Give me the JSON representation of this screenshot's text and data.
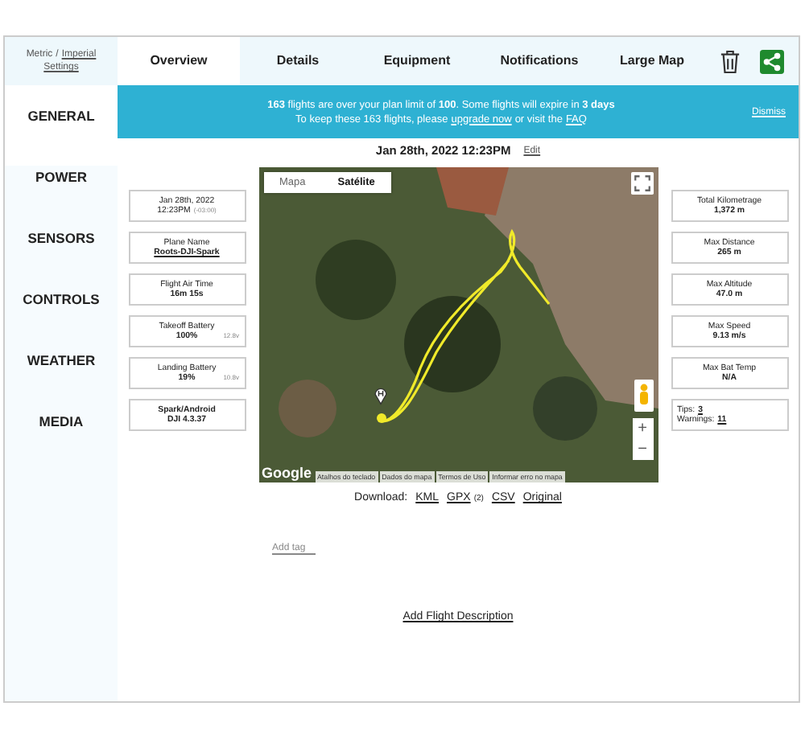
{
  "units": [
    {
      "label": "Metric",
      "selected": true
    },
    {
      "label": "Imperial",
      "selected": false
    }
  ],
  "units_separator": "/",
  "settings_link": "Settings",
  "tabs": [
    {
      "label": "Overview",
      "selected": true
    },
    {
      "label": "Details",
      "selected": false
    },
    {
      "label": "Equipment",
      "selected": false
    },
    {
      "label": "Notifications",
      "selected": false
    },
    {
      "label": "Large Map",
      "selected": false
    }
  ],
  "banner": {
    "line1": "**163** flights are over your plan limit of **100**. Some flights will expire in **3 days**",
    "line2": [
      {
        "text": "To keep these 163 flights, please",
        "link": false
      },
      {
        "text": "upgrade now",
        "link": true
      },
      {
        "text": "or visit the",
        "link": false
      },
      {
        "text": "FAQ",
        "link": true
      }
    ],
    "dismiss": "Dismiss"
  },
  "sidebar": {
    "items": [
      {
        "label": "GENERAL",
        "selected": true
      },
      {
        "label": "POWER",
        "selected": false
      },
      {
        "label": "SENSORS",
        "selected": false
      },
      {
        "label": "CONTROLS",
        "selected": false
      },
      {
        "label": "WEATHER",
        "selected": false
      },
      {
        "label": "MEDIA",
        "selected": false
      }
    ]
  },
  "flight_title": "Jan 28th, 2022 12:23PM",
  "edit_link": "Edit",
  "left_stats": [
    {
      "kind": "date",
      "label": "Jan 28th, 2022",
      "value": "12:23PM",
      "note": "(-03:00)"
    },
    {
      "kind": "stat",
      "label": "Plane Name",
      "value": "Roots-DJI-Spark",
      "link": true
    },
    {
      "kind": "stat",
      "label": "Flight Air Time",
      "value": "16m 15s",
      "link": false
    },
    {
      "kind": "stat",
      "label": "Takeoff Battery",
      "value": "100%",
      "note": "12.8v",
      "link": false
    },
    {
      "kind": "stat",
      "label": "Landing Battery",
      "value": "19%",
      "note": "10.8v",
      "link": false
    },
    {
      "kind": "device",
      "label": "Spark/Android",
      "value": "DJI 4.3.37"
    }
  ],
  "right_stats": [
    {
      "kind": "stat",
      "label": "Total Kilometrage",
      "value": "1,372 m"
    },
    {
      "kind": "stat",
      "label": "Max Distance",
      "value": "265 m"
    },
    {
      "kind": "stat",
      "label": "Max Altitude",
      "value": "47.0 m"
    },
    {
      "kind": "stat",
      "label": "Max Speed",
      "value": "9.13 m/s"
    },
    {
      "kind": "stat",
      "label": "Max Bat Temp",
      "value": "N/A"
    },
    {
      "kind": "counts",
      "lines": [
        {
          "label": "Tips:",
          "value": "3"
        },
        {
          "label": "Warnings:",
          "value": "11"
        }
      ]
    }
  ],
  "map": {
    "type_tabs": [
      {
        "label": "Mapa",
        "selected": false
      },
      {
        "label": "Satélite",
        "selected": true
      }
    ],
    "zoom_in": "+",
    "zoom_out": "−",
    "logo": "Google",
    "attribution": [
      "Atalhos do teclado",
      "Dados do mapa",
      "Termos de Uso",
      "Informar erro no mapa"
    ]
  },
  "download": {
    "label": "Download:",
    "links": [
      {
        "text": "KML"
      },
      {
        "text": "GPX",
        "note": "(2)"
      },
      {
        "text": "CSV"
      },
      {
        "text": "Original"
      }
    ]
  },
  "add_tag": "Add tag",
  "add_description": "Add Flight Description"
}
